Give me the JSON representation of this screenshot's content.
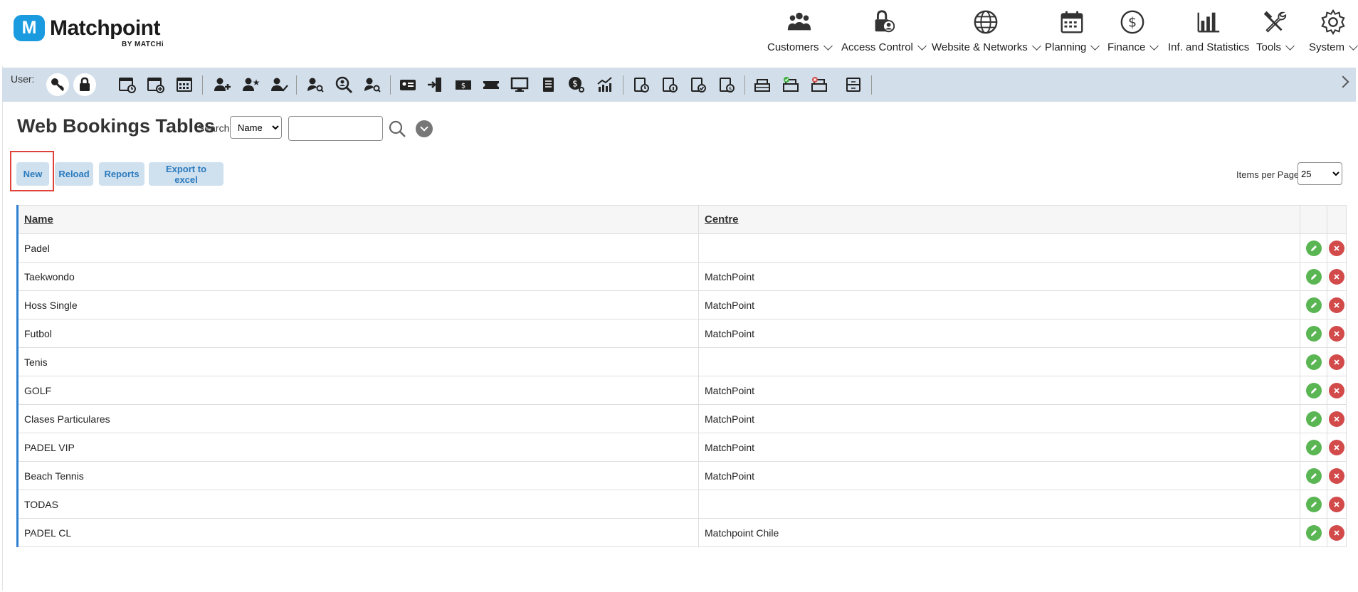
{
  "brand": {
    "name": "Matchpoint",
    "sub": "BY MATCHi",
    "badge": "M"
  },
  "nav": [
    {
      "label": "Customers",
      "icon": "customers-icon"
    },
    {
      "label": "Access Control",
      "icon": "access-control-icon"
    },
    {
      "label": "Website & Networks",
      "icon": "globe-icon"
    },
    {
      "label": "Planning",
      "icon": "calendar-icon"
    },
    {
      "label": "Finance",
      "icon": "dollar-icon"
    },
    {
      "label": "Inf. and Statistics",
      "icon": "bar-chart-icon"
    },
    {
      "label": "Tools",
      "icon": "tools-icon"
    },
    {
      "label": "System",
      "icon": "gear-icon"
    }
  ],
  "toolbar": {
    "user_label": "User:"
  },
  "page": {
    "title": "Web Bookings Tables",
    "search_label": "Search",
    "search_field": "Name",
    "search_value": ""
  },
  "actions": {
    "new": "New",
    "reload": "Reload",
    "reports": "Reports",
    "export": "Export to excel"
  },
  "pagination": {
    "label": "Items per Page",
    "value": "25"
  },
  "table": {
    "headers": {
      "name": "Name",
      "centre": "Centre"
    },
    "rows": [
      {
        "name": "Padel",
        "centre": ""
      },
      {
        "name": "Taekwondo",
        "centre": "MatchPoint"
      },
      {
        "name": "Hoss Single",
        "centre": "MatchPoint"
      },
      {
        "name": "Futbol",
        "centre": "MatchPoint"
      },
      {
        "name": "Tenis",
        "centre": ""
      },
      {
        "name": "GOLF",
        "centre": "MatchPoint"
      },
      {
        "name": "Clases Particulares",
        "centre": "MatchPoint"
      },
      {
        "name": "PADEL VIP",
        "centre": "MatchPoint"
      },
      {
        "name": "Beach Tennis",
        "centre": "MatchPoint"
      },
      {
        "name": "TODAS",
        "centre": ""
      },
      {
        "name": "PADEL CL",
        "centre": "Matchpoint Chile"
      }
    ]
  },
  "colors": {
    "accent": "#1a9be0",
    "toolbar_bg": "#d2dfeb",
    "button_bg": "#cfe0ef",
    "edit": "#5ab553",
    "delete": "#d24a4a",
    "highlight": "#e0413a"
  }
}
